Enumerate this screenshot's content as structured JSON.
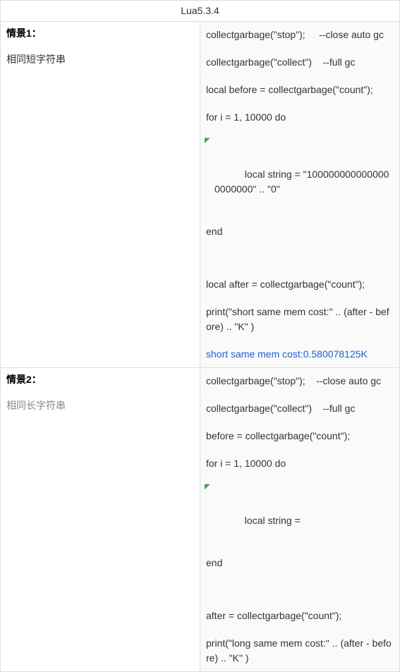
{
  "header": {
    "title": "Lua5.3.4"
  },
  "rows": [
    {
      "left": {
        "title": "情景1：",
        "sub": "相同短字符串",
        "sub_gray": false
      },
      "code": {
        "l1": "collectgarbage(\"stop\");     --close auto gc",
        "l2": "collectgarbage(\"collect\")    --full gc",
        "l3": "local before = collectgarbage(\"count\");",
        "l4": "for i = 1, 10000 do",
        "l5": "   local string = \"1000000000000000000000\" .. \"0\"",
        "l6": "end",
        "l7": "local after = collectgarbage(\"count\");",
        "l8": "print(\"short same mem cost:\" .. (after - before) .. \"K\" )",
        "output": "short same mem cost:0.580078125K"
      }
    },
    {
      "left": {
        "title": "情景2：",
        "sub": "相同长字符串",
        "sub_gray": true
      },
      "code": {
        "l1": "collectgarbage(\"stop\");    --close auto gc",
        "l2": "collectgarbage(\"collect\")    --full gc",
        "l3": "before = collectgarbage(\"count\");",
        "l4": "for i = 1, 10000 do",
        "l5": "   local string =",
        "l6": "end",
        "l7": "after = collectgarbage(\"count\");",
        "l8": "print(\"long same mem cost:\" .. (after - before) .. \"K\" )",
        "output": ""
      }
    }
  ]
}
